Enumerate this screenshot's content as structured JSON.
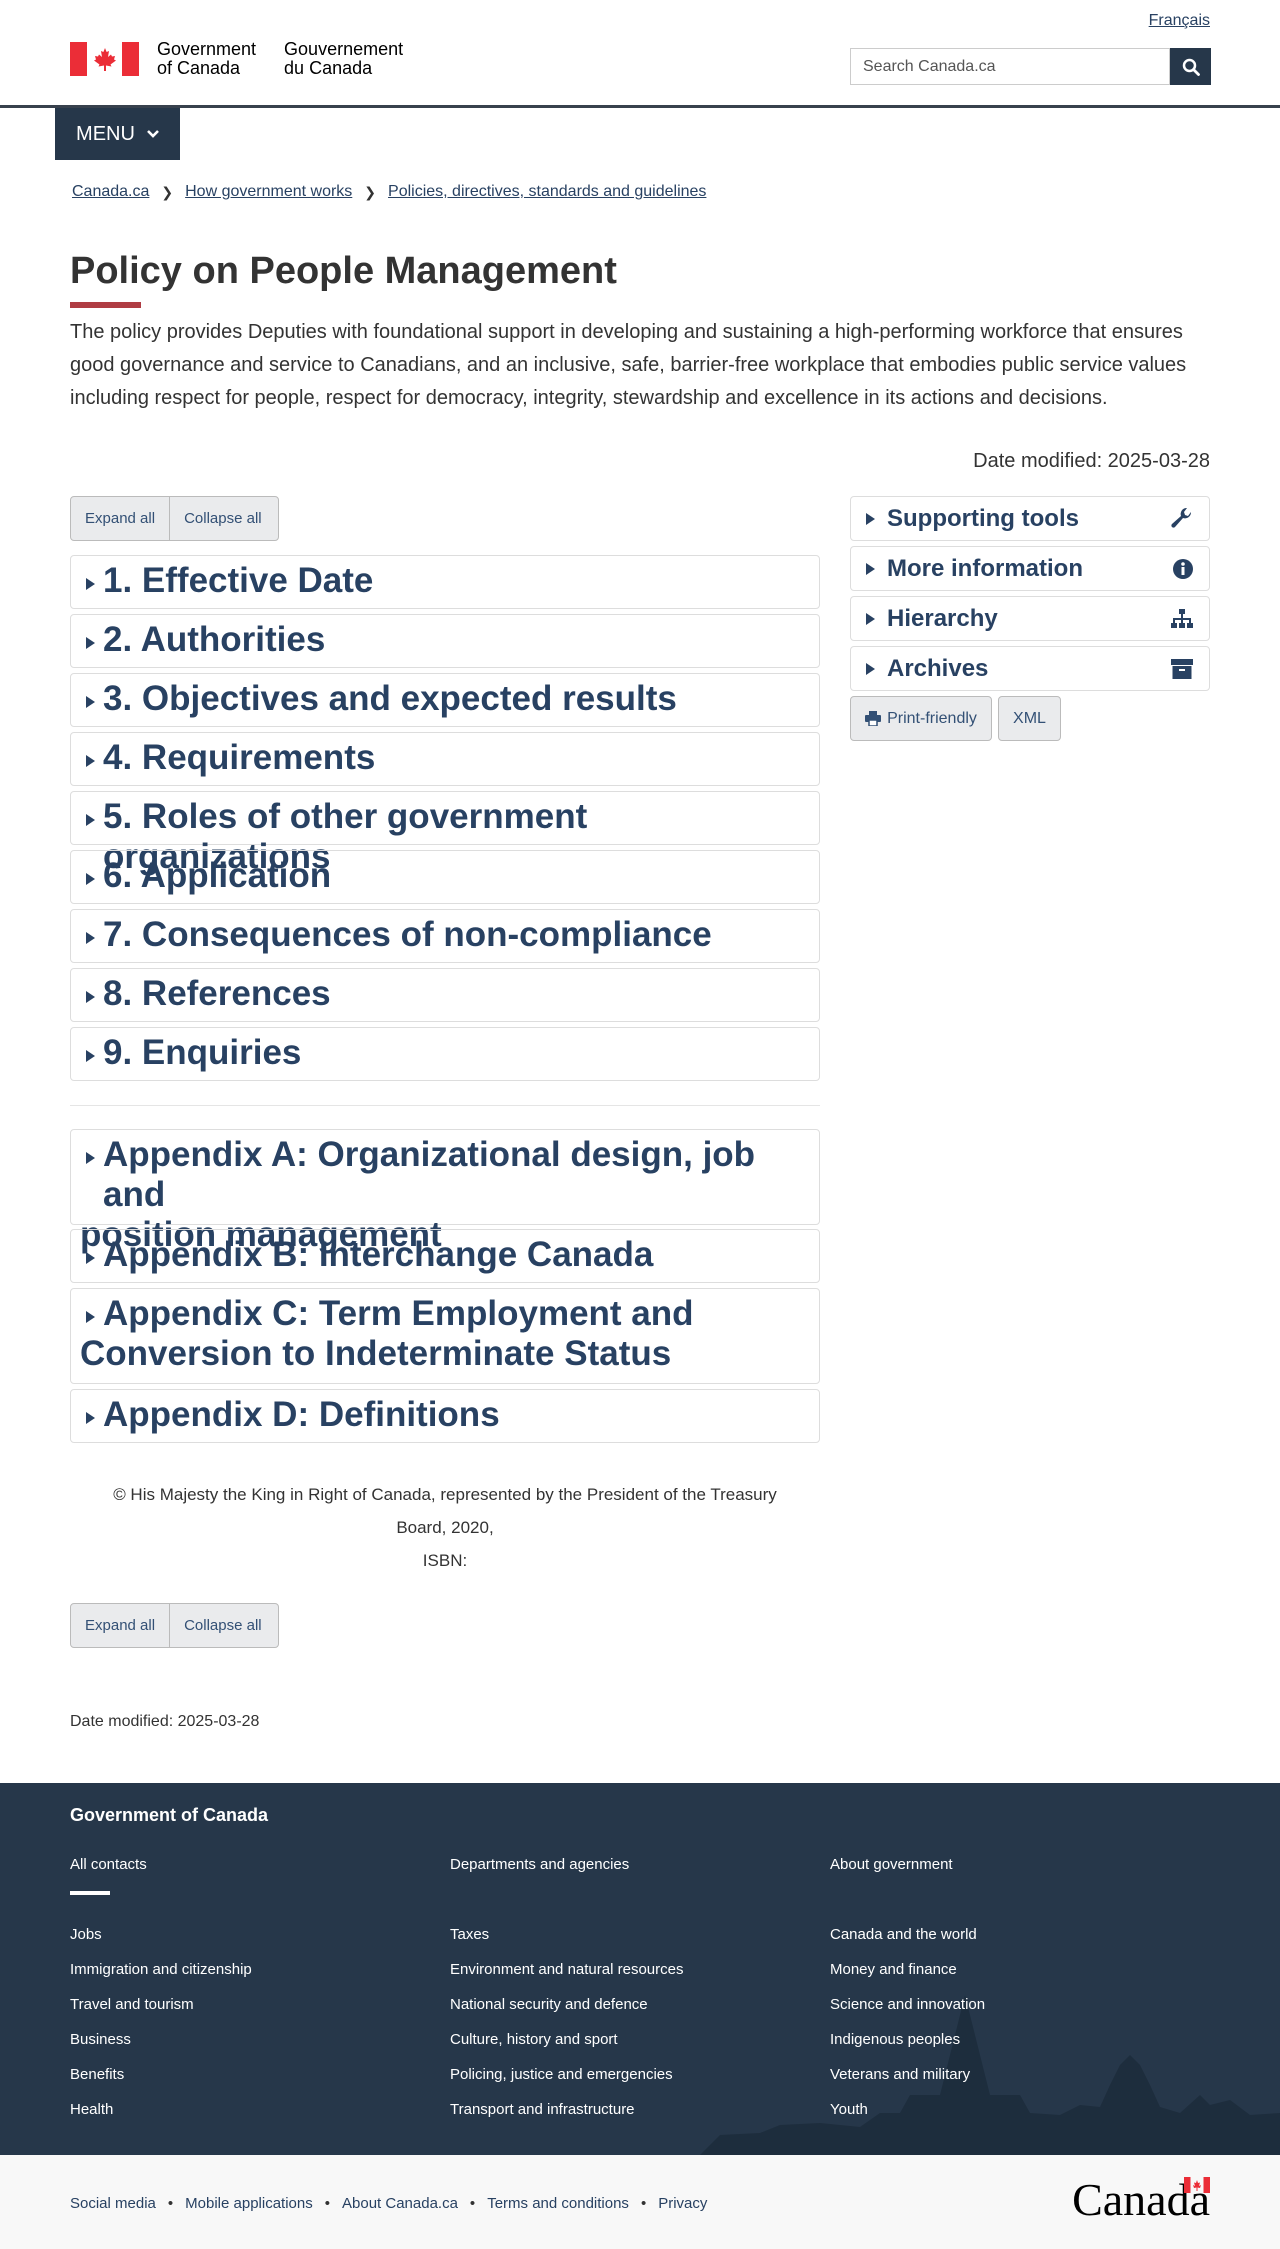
{
  "header": {
    "lang_link": "Français",
    "signature_en_1": "Government",
    "signature_en_2": "of Canada",
    "signature_fr_1": "Gouvernement",
    "signature_fr_2": "du Canada",
    "search_placeholder": "Search Canada.ca",
    "menu_label": "MENU"
  },
  "breadcrumbs": [
    "Canada.ca",
    "How government works",
    "Policies, directives, standards and guidelines"
  ],
  "page": {
    "title": "Policy on People Management",
    "lead": "The policy provides Deputies with foundational support in developing and sustaining a high-performing workforce that ensures good governance and service to Canadians, and an inclusive, safe, barrier-free workplace that embodies public service values including respect for people, respect for democracy, integrity, stewardship and excellence in its actions and decisions.",
    "date_modified": "Date modified: 2025-03-28"
  },
  "controls": {
    "expand_all": "Expand all",
    "collapse_all": "Collapse all"
  },
  "sections": [
    "1. Effective Date",
    "2. Authorities",
    "3. Objectives and expected results",
    "4. Requirements",
    "5. Roles of other government organizations",
    "6. Application",
    "7. Consequences of non-compliance",
    "8. References",
    "9. Enquiries"
  ],
  "appendices": [
    {
      "line1": "Appendix A: Organizational design, job and",
      "line2": "position management"
    },
    {
      "line1": "Appendix B: Interchange Canada",
      "line2": ""
    },
    {
      "line1": "Appendix C: Term Employment and",
      "line2": "Conversion to Indeterminate Status"
    },
    {
      "line1": "Appendix D: Definitions",
      "line2": ""
    }
  ],
  "sidebar": {
    "items": [
      {
        "label": "Supporting tools",
        "icon": "wrench-icon"
      },
      {
        "label": "More information",
        "icon": "info-icon"
      },
      {
        "label": "Hierarchy",
        "icon": "sitemap-icon"
      },
      {
        "label": "Archives",
        "icon": "archive-icon"
      }
    ],
    "print_friendly": "Print-friendly",
    "xml": "XML"
  },
  "copyright": {
    "line1": "© His Majesty the King in Right of Canada, represented by the President of the Treasury",
    "line2": "Board, 2020,",
    "line3": "ISBN:"
  },
  "bottom_date": "Date modified: 2025-03-28",
  "footer": {
    "title": "Government of Canada",
    "top_links": [
      "All contacts",
      "Departments and agencies",
      "About government"
    ],
    "col1": [
      "Jobs",
      "Immigration and citizenship",
      "Travel and tourism",
      "Business",
      "Benefits",
      "Health"
    ],
    "col2": [
      "Taxes",
      "Environment and natural resources",
      "National security and defence",
      "Culture, history and sport",
      "Policing, justice and emergencies",
      "Transport and infrastructure"
    ],
    "col3": [
      "Canada and the world",
      "Money and finance",
      "Science and innovation",
      "Indigenous peoples",
      "Veterans and military",
      "Youth"
    ],
    "sub_links": [
      "Social media",
      "Mobile applications",
      "About Canada.ca",
      "Terms and conditions",
      "Privacy"
    ],
    "wordmark": "Canada"
  },
  "colors": {
    "navy": "#26374a",
    "link": "#284162",
    "flag_red": "#eb2d37",
    "title_bar": "#af3c43"
  }
}
